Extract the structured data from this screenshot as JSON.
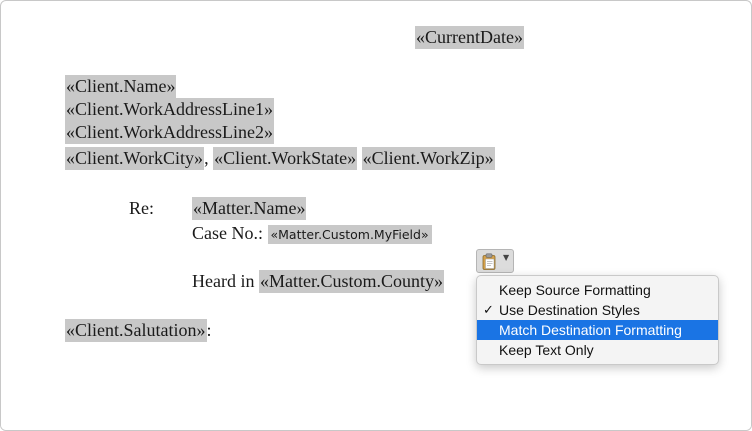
{
  "document": {
    "current_date": "«CurrentDate»",
    "client_name": "«Client.Name»",
    "address_line1": "«Client.WorkAddressLine1»",
    "address_line2": "«Client.WorkAddressLine2»",
    "city": "«Client.WorkCity»",
    "city_sep": ", ",
    "state": "«Client.WorkState»",
    "zip": "«Client.WorkZip»",
    "re_label": "Re:",
    "matter_name": "«Matter.Name»",
    "case_no_label": "Case No.: ",
    "custom_field": "«Matter.Custom.MyField»",
    "heard_in_label": "Heard in ",
    "county_field": "«Matter.Custom.County»",
    "salutation": "«Client.Salutation»",
    "salutation_suffix": ":"
  },
  "paste_options": {
    "button_icon": "clipboard-icon",
    "caret_icon": "chevron-down-icon",
    "items": [
      {
        "label": "Keep Source Formatting",
        "checked": false,
        "selected": false
      },
      {
        "label": "Use Destination Styles",
        "checked": true,
        "selected": false
      },
      {
        "label": "Match Destination Formatting",
        "checked": false,
        "selected": true
      },
      {
        "label": "Keep Text Only",
        "checked": false,
        "selected": false
      }
    ],
    "check_glyph": "✓"
  },
  "colors": {
    "field_shading": "#c8c8c8",
    "menu_highlight": "#1a74e4"
  }
}
